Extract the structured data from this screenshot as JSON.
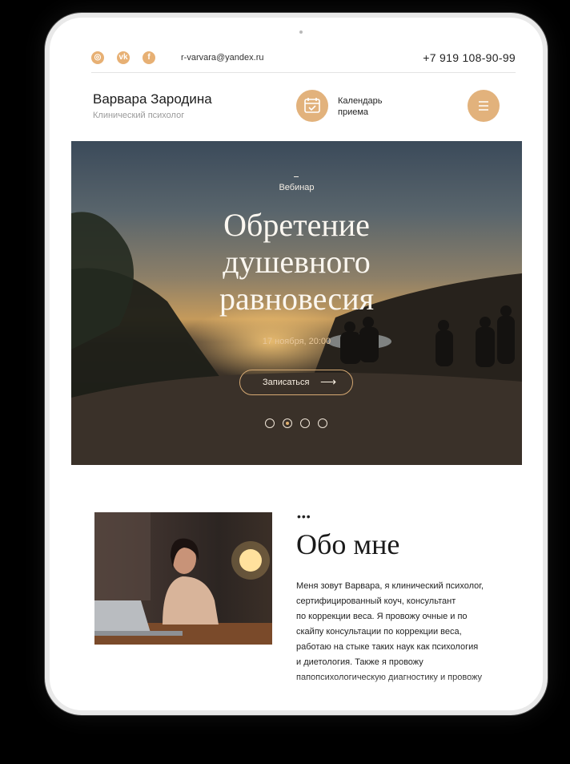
{
  "header": {
    "email": "r-varvara@yandex.ru",
    "phone": "+7 919 108-90-99",
    "social_icons": [
      "instagram-icon",
      "vk-icon",
      "facebook-icon"
    ]
  },
  "profile": {
    "name": "Варвара Зародина",
    "role": "Клинический психолог"
  },
  "calendar": {
    "label_line1": "Календарь",
    "label_line2": "приема"
  },
  "hero": {
    "kicker": "Вебинар",
    "title_line1": "Обретение",
    "title_line2": "душевного",
    "title_line3": "равновесия",
    "date": "17 ноября, 20:00",
    "button_label": "Записаться",
    "slides": 4,
    "active_slide": 2
  },
  "about": {
    "title": "Обо мне",
    "lines": [
      "Меня зовут Варвара, я клинический психолог,",
      "сертифицированный коуч, консультант",
      "по коррекции веса. Я провожу очные и по",
      "скайпу консультации по коррекции веса,",
      "работаю на стыке таких наук как психология",
      "и диетология. Также я провожу",
      "папопсихологическую диагностику и провожу"
    ]
  },
  "colors": {
    "accent": "#e2b27c",
    "background": "#000000",
    "screen": "#ffffff"
  }
}
